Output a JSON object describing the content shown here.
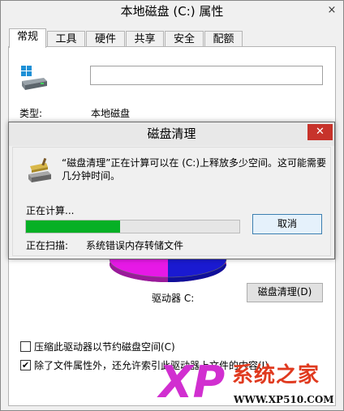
{
  "window": {
    "title": "本地磁盘 (C:) 属性",
    "close_glyph": "×",
    "tabs": [
      "常规",
      "工具",
      "硬件",
      "共享",
      "安全",
      "配额"
    ],
    "active_tab": 0
  },
  "general": {
    "name_value": "",
    "type_label": "类型:",
    "type_value": "本地磁盘",
    "drive_label": "驱动器 C:",
    "cleanup_button": "磁盘清理(D)",
    "compress_checkbox": {
      "label": "压缩此驱动器以节约磁盘空间(C)",
      "checked": false
    },
    "index_checkbox": {
      "label": "除了文件属性外，还允许索引此驱动器上文件的内容(I)",
      "checked": true
    },
    "pie_colors": [
      "#e619e6",
      "#1a1ad1"
    ]
  },
  "dialog": {
    "title": "磁盘清理",
    "close_glyph": "✕",
    "message": "“磁盘清理”正在计算可以在 (C:)上释放多少空间。这可能需要几分钟时间。",
    "status": "正在计算...",
    "progress": 0.44,
    "cancel_button": "取消",
    "scan_label": "正在扫描:",
    "scan_value": "系统错误内存转储文件",
    "progress_color": "#06b025",
    "close_color": "#c7332b"
  },
  "watermark": {
    "xp": "XP",
    "cn": "系统之家",
    "url": "WWW.XP510.COM"
  }
}
